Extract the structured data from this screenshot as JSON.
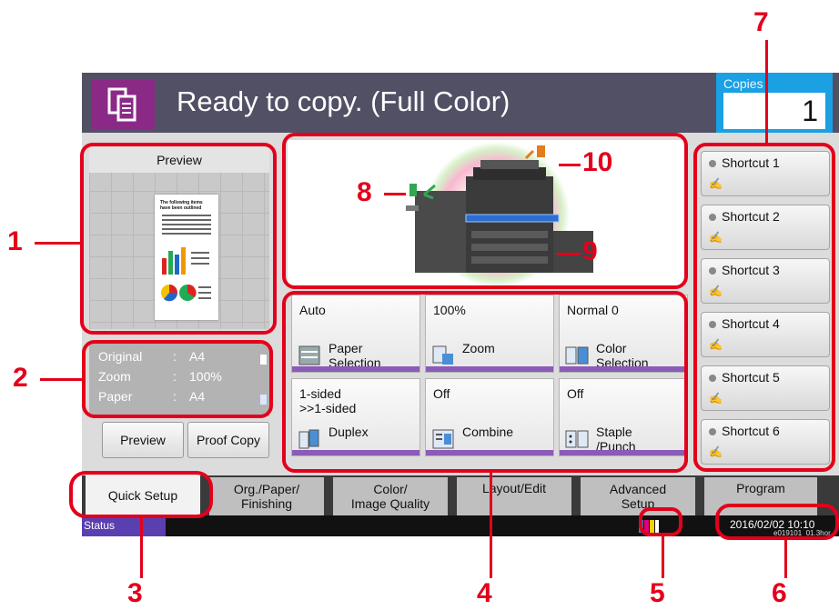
{
  "header": {
    "title": "Ready to copy. (Full Color)",
    "copies_label": "Copies",
    "copies_value": "1"
  },
  "preview": {
    "header_label": "Preview",
    "doc_title": "The following items have been outlined"
  },
  "info": [
    {
      "label": "Original",
      "value": "A4"
    },
    {
      "label": "Zoom",
      "value": "100%"
    },
    {
      "label": "Paper",
      "value": "A4"
    }
  ],
  "info_separator": ":",
  "buttons": {
    "preview": "Preview",
    "proof_copy": "Proof Copy"
  },
  "functions": [
    {
      "value": "Auto",
      "label": "Paper\nSelection",
      "icon": "paper-tray-icon"
    },
    {
      "value": "100%",
      "label": "Zoom",
      "icon": "zoom-icon"
    },
    {
      "value": "Normal 0",
      "label": "Color\nSelection",
      "icon": "color-selection-icon"
    },
    {
      "value": "1-sided\n>>1-sided",
      "label": "Duplex",
      "icon": "duplex-icon"
    },
    {
      "value": "Off",
      "label": "Combine",
      "icon": "combine-icon"
    },
    {
      "value": "Off",
      "label": "Staple\n/Punch",
      "icon": "staple-punch-icon"
    }
  ],
  "shortcuts": [
    "Shortcut 1",
    "Shortcut 2",
    "Shortcut 3",
    "Shortcut 4",
    "Shortcut 5",
    "Shortcut 6"
  ],
  "tabs": [
    "Quick Setup",
    "Org./Paper/\nFinishing",
    "Color/\nImage Quality",
    "Layout/Edit",
    "Advanced\nSetup",
    "Program"
  ],
  "status": {
    "label": "Status",
    "datetime": "2016/02/02  10:10",
    "version": "e019101_01.3hor"
  },
  "callouts": [
    "1",
    "2",
    "3",
    "4",
    "5",
    "6",
    "7",
    "8",
    "9",
    "10"
  ],
  "colors": {
    "callout": "#e3001b",
    "topbar": "#525065",
    "app_icon": "#8b2a86",
    "copies": "#1aa0e3",
    "status": "#5a3fb1",
    "stripe": "#8b5bb8"
  }
}
